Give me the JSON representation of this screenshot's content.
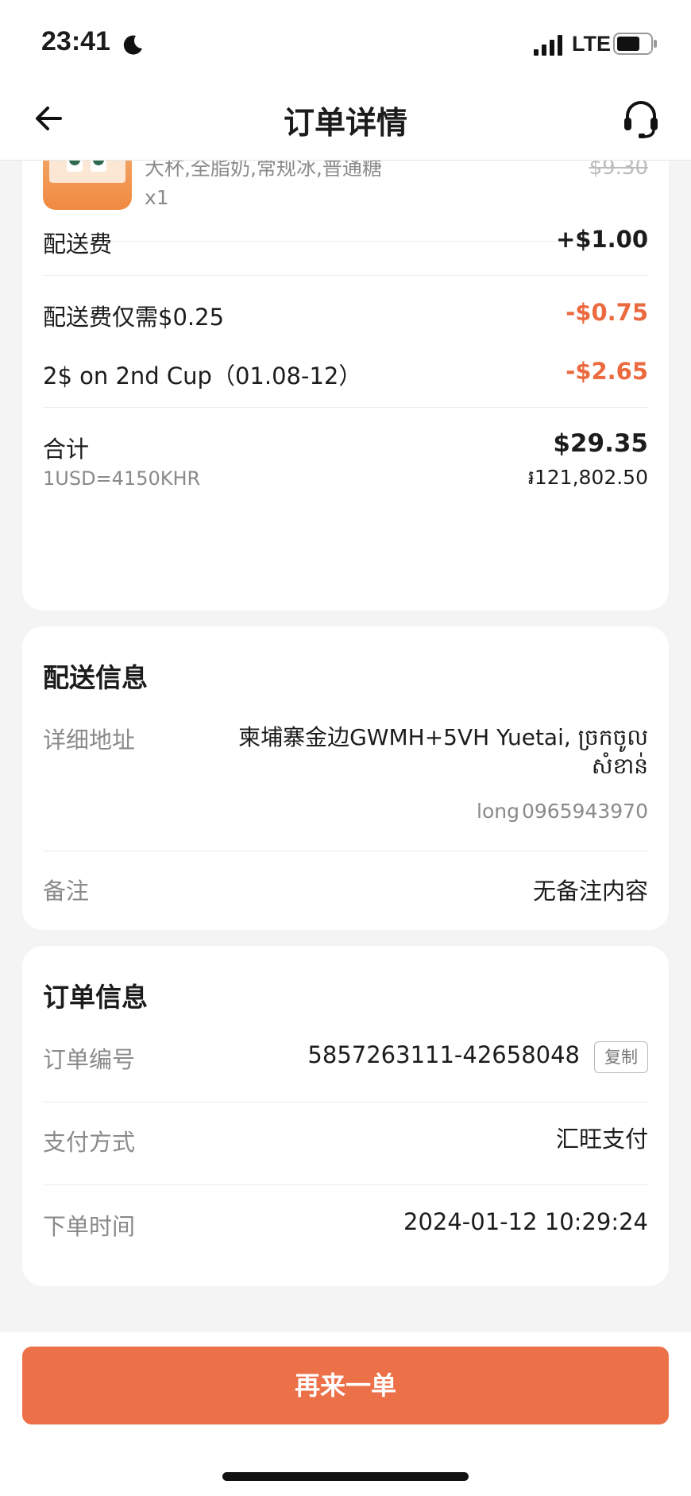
{
  "status_bar": {
    "time": "23:41",
    "network": "LTE"
  },
  "header": {
    "title": "订单详情",
    "back_icon": "arrow-left-icon",
    "support_icon": "headset-icon"
  },
  "product": {
    "spec": "大杯,全脂奶,常规冰,普通糖",
    "quantity": "x1",
    "original_price": "$9.30"
  },
  "fees": {
    "delivery_fee_label": "配送费",
    "delivery_fee_value": "+$1.00",
    "discounts": [
      {
        "label": "配送费仅需$0.25",
        "value": "-$0.75"
      },
      {
        "label": "2$ on 2nd Cup（01.08-12）",
        "value": "-$2.65"
      }
    ],
    "total_label": "合计",
    "total_value": "$29.35",
    "exchange_rate": "1USD=4150KHR",
    "total_khr": "៛121,802.50"
  },
  "delivery": {
    "title": "配送信息",
    "address_label": "详细地址",
    "address_line1": "柬埔寨金边GWMH+5VH Yuetai, ច្រកចូល",
    "address_line2": "សំខាន់",
    "contact_name": "long",
    "contact_phone": "0965943970",
    "note_label": "备注",
    "note_value": "无备注内容"
  },
  "order": {
    "title": "订单信息",
    "number_label": "订单编号",
    "number_value": "5857263111-42658048",
    "copy_label": "复制",
    "payment_label": "支付方式",
    "payment_value": "汇旺支付",
    "time_label": "下单时间",
    "time_value": "2024-01-12 10:29:24"
  },
  "actions": {
    "reorder_label": "再来一单"
  },
  "colors": {
    "accent": "#ec7048",
    "discount": "#ec6a3f",
    "background": "#f4f4f4"
  }
}
